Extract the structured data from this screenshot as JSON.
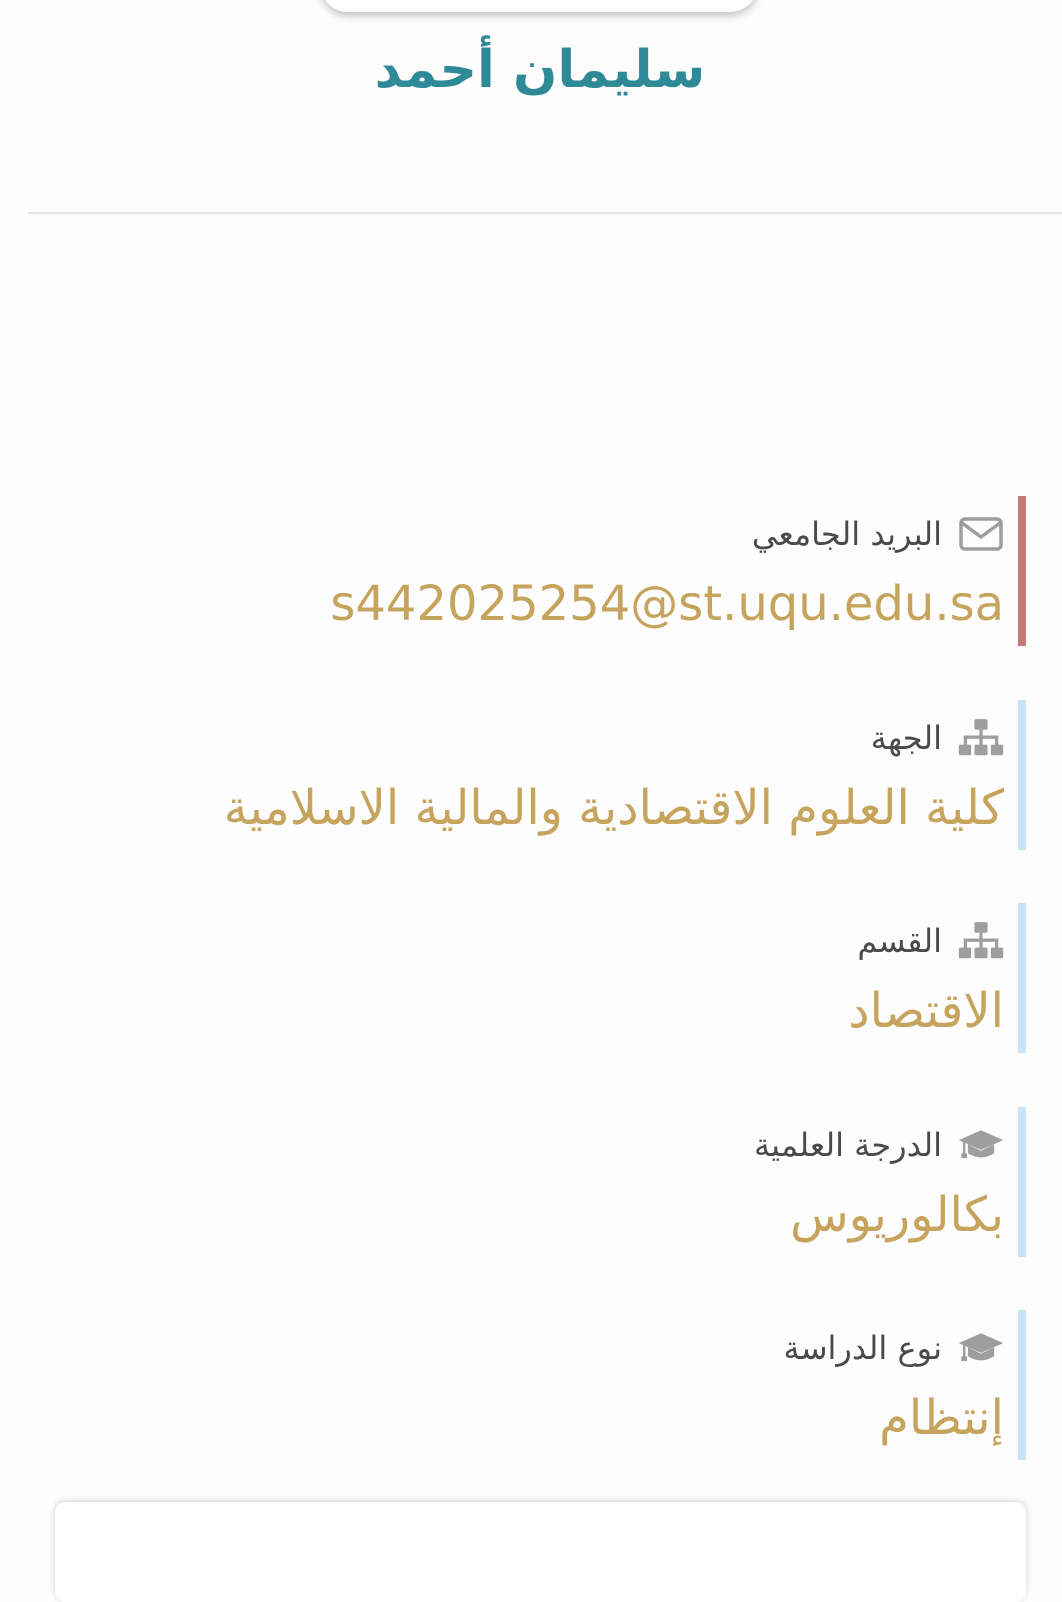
{
  "profile": {
    "name": "سليمان أحمد"
  },
  "info": [
    {
      "icon": "envelope-icon",
      "label": "البريد الجامعي",
      "value": "s442025254@st.uqu.edu.sa",
      "accent": "#c47a78"
    },
    {
      "icon": "sitemap-icon",
      "label": "الجهة",
      "value": "كلية العلوم الاقتصادية والمالية الاسلامية",
      "accent": "#c7e3f7"
    },
    {
      "icon": "sitemap-icon",
      "label": "القسم",
      "value": "الاقتصاد",
      "accent": "#c7e3f7"
    },
    {
      "icon": "graduation-cap-icon",
      "label": "الدرجة العلمية",
      "value": "بكالوريوس",
      "accent": "#c7e3f7"
    },
    {
      "icon": "graduation-cap-icon",
      "label": "نوع الدراسة",
      "value": "إنتظام",
      "accent": "#c7e3f7"
    }
  ],
  "colors": {
    "name": "#2e8a97",
    "value": "#c6a45e",
    "label": "#4a4a4a",
    "icon": "#9e9e9e"
  }
}
